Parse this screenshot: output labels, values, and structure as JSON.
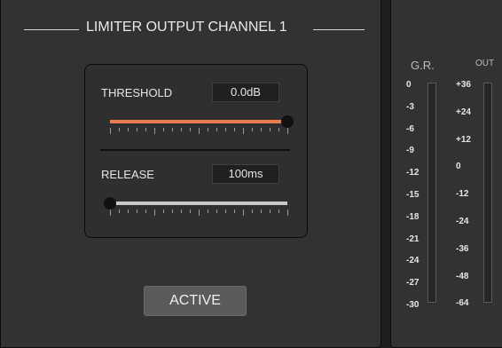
{
  "limiter": {
    "title": "LIMITER OUTPUT CHANNEL 1",
    "threshold": {
      "label": "THRESHOLD",
      "value": "0.0dB",
      "level": 1.0
    },
    "release": {
      "label": "RELEASE",
      "value": "100ms",
      "level": 0.0
    },
    "active_label": "ACTIVE"
  },
  "meters": {
    "gr": {
      "label": "G.R.",
      "scale": [
        "0",
        "-3",
        "-6",
        "-9",
        "-12",
        "-15",
        "-18",
        "-21",
        "-24",
        "-27",
        "-30"
      ]
    },
    "out": {
      "label": "OUT",
      "scale": [
        "+36",
        "+24",
        "+12",
        "0",
        "-12",
        "-24",
        "-36",
        "-48",
        "-64"
      ]
    }
  },
  "colors": {
    "accent": "#e87d4e",
    "panel": "#323232",
    "background": "#1e1e1e"
  }
}
